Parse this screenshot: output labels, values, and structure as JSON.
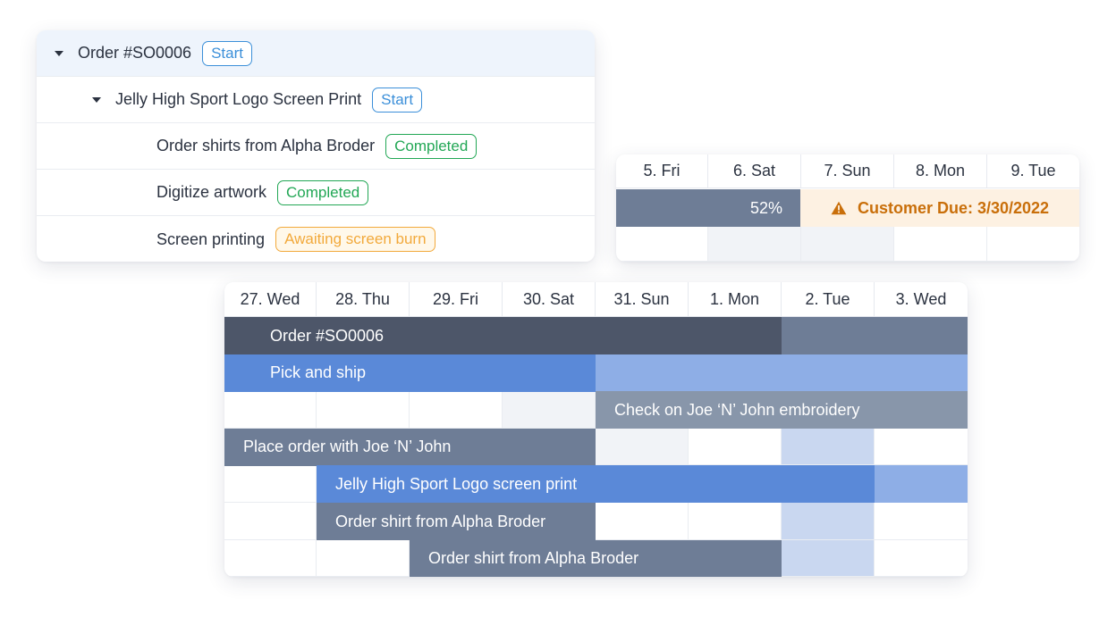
{
  "tree": {
    "rows": [
      {
        "label": "Order #SO0006",
        "status": "Start",
        "status_type": "start"
      },
      {
        "label": "Jelly High Sport Logo Screen Print",
        "status": "Start",
        "status_type": "start"
      },
      {
        "label": "Order shirts from Alpha Broder",
        "status": "Completed",
        "status_type": "completed"
      },
      {
        "label": "Digitize artwork",
        "status": "Completed",
        "status_type": "completed"
      },
      {
        "label": "Screen printing",
        "status": "Awaiting screen burn",
        "status_type": "awaiting"
      }
    ]
  },
  "small_timeline": {
    "days": [
      "5. Fri",
      "6. Sat",
      "7. Sun",
      "8. Mon",
      "9. Tue"
    ],
    "progress_label": "52%",
    "due_label": "Customer Due: 3/30/2022",
    "warning_icon": "warning-triangle-icon"
  },
  "big_timeline": {
    "days": [
      "27. Wed",
      "28. Thu",
      "29. Fri",
      "30. Sat",
      "31. Sun",
      "1. Mon",
      "2. Tue",
      "3. Wed"
    ],
    "tasks": [
      {
        "label": "Order #SO0006"
      },
      {
        "label": "Pick and ship"
      },
      {
        "label": "Check on Joe ‘N’ John embroidery"
      },
      {
        "label": "Place order with Joe ‘N’ John"
      },
      {
        "label": "Jelly High Sport Logo screen print"
      },
      {
        "label": "Order shirt from Alpha Broder"
      },
      {
        "label": "Order shirt from Alpha Broder"
      }
    ]
  },
  "colors": {
    "start": "#3b8fd9",
    "completed": "#22a755",
    "awaiting": "#f2a93b",
    "bar_dark": "#4d5669",
    "bar_gray": "#6e7d96",
    "bar_blue": "#5a89d8",
    "bar_blue_light": "#8eaee6",
    "bar_gray_light": "#8896aa",
    "due_text": "#c96f0a"
  }
}
